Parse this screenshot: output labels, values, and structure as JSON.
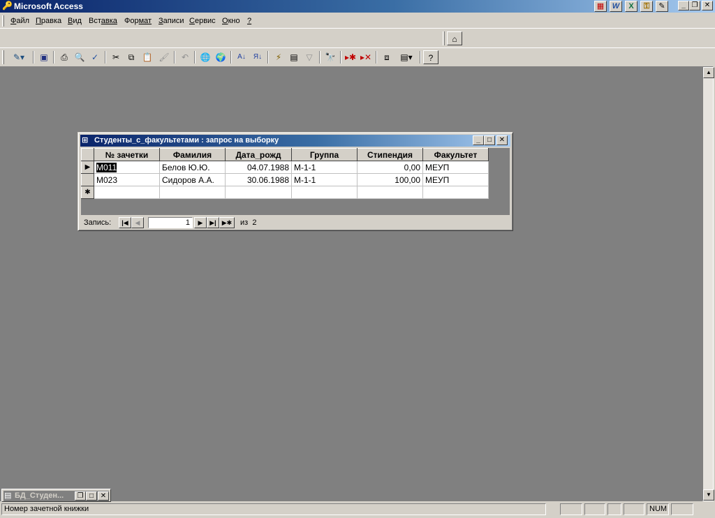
{
  "app": {
    "title": "Microsoft Access"
  },
  "title_bar_tools": [
    {
      "icon": "office-shortcut-icon",
      "glyph": "▦"
    },
    {
      "icon": "word-icon",
      "glyph": "W"
    },
    {
      "icon": "excel-icon",
      "glyph": "X"
    },
    {
      "icon": "access-key-icon",
      "glyph": "⚿"
    },
    {
      "icon": "assistant-icon",
      "glyph": "✎"
    }
  ],
  "menu": [
    {
      "key": "Ф",
      "rest": "айл"
    },
    {
      "key": "П",
      "rest": "равка"
    },
    {
      "key": "В",
      "rest": "ид"
    },
    {
      "key": "Вст",
      "rest": "авка",
      "split": true
    },
    {
      "key": "Фор",
      "rest": "мат",
      "split": true
    },
    {
      "key": "З",
      "rest": "аписи"
    },
    {
      "key": "С",
      "rest": "ервис"
    },
    {
      "key": "О",
      "rest": "кно"
    },
    {
      "key": "?",
      "rest": ""
    }
  ],
  "child_window": {
    "title": "Студенты_с_факультетами : запрос на выборку",
    "columns": [
      "№ зачетки",
      "Фамилия",
      "Дата_рожд",
      "Группа",
      "Стипендия",
      "Факультет"
    ],
    "rows": [
      {
        "selector": "▶",
        "cells": [
          "М011",
          "Белов Ю.Ю.",
          "04.07.1988",
          "М-1-1",
          "0,00",
          "МЕУП"
        ]
      },
      {
        "selector": "",
        "cells": [
          "М023",
          "Сидоров А.А.",
          "30.06.1988",
          "М-1-1",
          "100,00",
          "МЕУП"
        ]
      },
      {
        "selector": "✱",
        "cells": [
          "",
          "",
          "",
          "",
          "",
          ""
        ]
      }
    ],
    "nav": {
      "label": "Запись:",
      "current": "1",
      "of_label": "из",
      "total": "2"
    }
  },
  "minimized_window": {
    "title": "БД_Студен..."
  },
  "status": {
    "text": "Номер зачетной книжки",
    "num": "NUM"
  }
}
